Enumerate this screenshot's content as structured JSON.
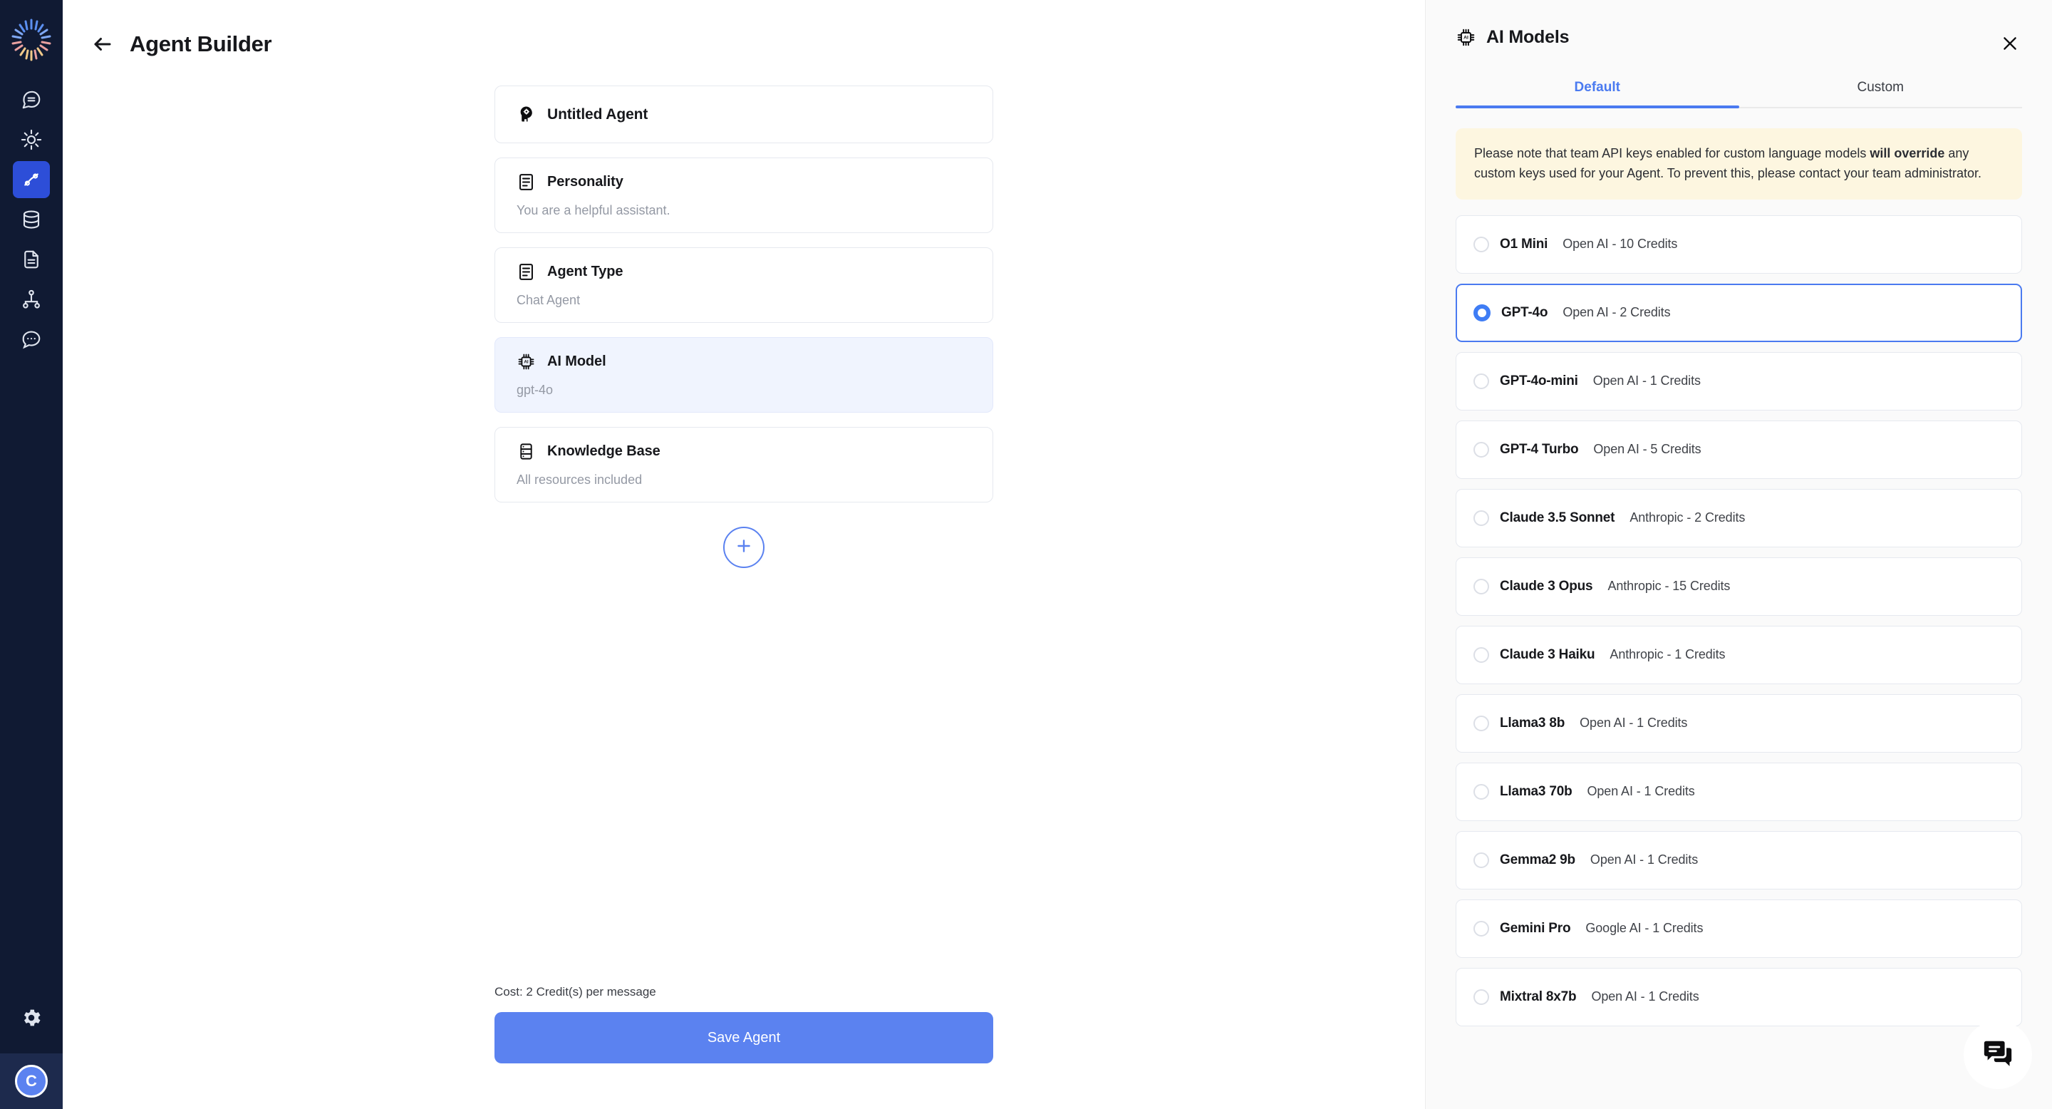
{
  "sidebar": {
    "logo_name": "app-logo",
    "items": [
      {
        "icon": "chat-bubble-icon",
        "name": "sidebar-item-chat",
        "active": false
      },
      {
        "icon": "sparkle-sun-icon",
        "name": "sidebar-item-discover",
        "active": false
      },
      {
        "icon": "workflow-icon",
        "name": "sidebar-item-agents",
        "active": true
      },
      {
        "icon": "database-icon",
        "name": "sidebar-item-data",
        "active": false
      },
      {
        "icon": "document-icon",
        "name": "sidebar-item-documents",
        "active": false
      },
      {
        "icon": "hierarchy-icon",
        "name": "sidebar-item-teams",
        "active": false
      },
      {
        "icon": "chat-dots-icon",
        "name": "sidebar-item-conversations",
        "active": false
      }
    ],
    "settings_icon": "gear-icon",
    "avatar_initial": "C"
  },
  "header": {
    "back_icon": "arrow-left-icon",
    "title": "Agent Builder"
  },
  "builder": {
    "cards": [
      {
        "icon": "brain-head-icon",
        "label": "Untitled Agent",
        "value": null,
        "selected": false,
        "type": "title"
      },
      {
        "icon": "note-icon",
        "label": "Personality",
        "value": "You are a helpful assistant.",
        "selected": false,
        "type": "field"
      },
      {
        "icon": "note-icon",
        "label": "Agent Type",
        "value": "Chat Agent",
        "selected": false,
        "type": "field"
      },
      {
        "icon": "cpu-ai-icon",
        "label": "AI Model",
        "value": "gpt-4o",
        "selected": true,
        "type": "field"
      },
      {
        "icon": "database-icon",
        "label": "Knowledge Base",
        "value": "All resources included",
        "selected": false,
        "type": "field"
      }
    ],
    "add_button_icon": "plus-icon",
    "cost_text": "Cost: 2 Credit(s) per message",
    "save_label": "Save Agent"
  },
  "panel": {
    "icon": "cpu-ai-icon",
    "title": "AI Models",
    "close_icon": "close-icon",
    "tabs": [
      {
        "label": "Default",
        "active": true
      },
      {
        "label": "Custom",
        "active": false
      }
    ],
    "notice": {
      "part1": "Please note that team API keys enabled for custom language models ",
      "bold1": "will override",
      "part2": " any custom keys used for your Agent. To prevent this, please contact your team administrator."
    },
    "models": [
      {
        "name": "O1 Mini",
        "meta": "Open AI - 10 Credits",
        "selected": false
      },
      {
        "name": "GPT-4o",
        "meta": "Open AI - 2 Credits",
        "selected": true
      },
      {
        "name": "GPT-4o-mini",
        "meta": "Open AI - 1 Credits",
        "selected": false
      },
      {
        "name": "GPT-4 Turbo",
        "meta": "Open AI - 5 Credits",
        "selected": false
      },
      {
        "name": "Claude 3.5 Sonnet",
        "meta": "Anthropic - 2 Credits",
        "selected": false
      },
      {
        "name": "Claude 3 Opus",
        "meta": "Anthropic - 15 Credits",
        "selected": false
      },
      {
        "name": "Claude 3 Haiku",
        "meta": "Anthropic - 1 Credits",
        "selected": false
      },
      {
        "name": "Llama3 8b",
        "meta": "Open AI - 1 Credits",
        "selected": false
      },
      {
        "name": "Llama3 70b",
        "meta": "Open AI - 1 Credits",
        "selected": false
      },
      {
        "name": "Gemma2 9b",
        "meta": "Open AI - 1 Credits",
        "selected": false
      },
      {
        "name": "Gemini Pro",
        "meta": "Google AI - 1 Credits",
        "selected": false
      },
      {
        "name": "Mixtral 8x7b",
        "meta": "Open AI - 1 Credits",
        "selected": false
      }
    ],
    "chat_fab_icon": "chat-bubbles-icon"
  },
  "colors": {
    "accent": "#4a7af0",
    "primary_button": "#5b82f0",
    "rail_bg": "#101a33",
    "notice_bg": "#fdf6e0",
    "selected_card_bg": "#f0f4fe"
  }
}
